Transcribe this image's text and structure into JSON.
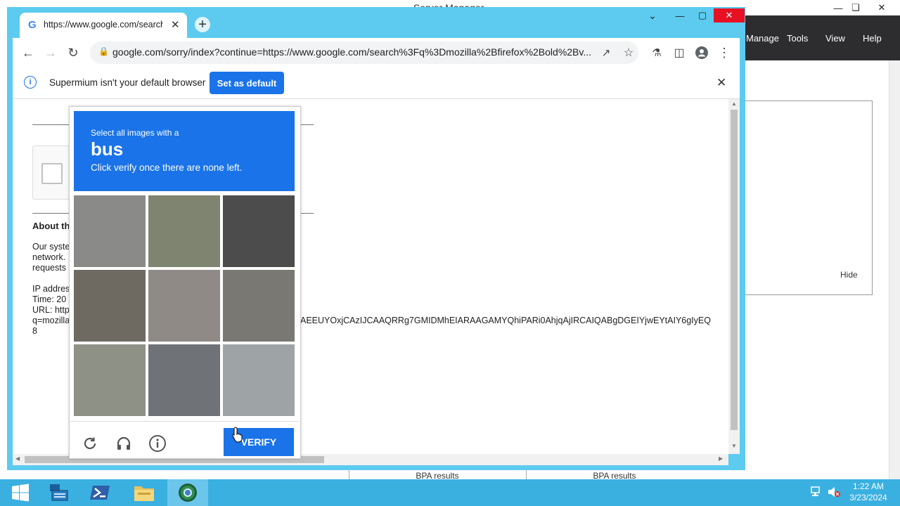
{
  "server_manager": {
    "title": "Server Manager",
    "menu": [
      "Manage",
      "Tools",
      "View",
      "Help"
    ],
    "hide_label": "Hide",
    "bpa_results": [
      "BPA results",
      "BPA results"
    ]
  },
  "browser": {
    "tab_title": "https://www.google.com/search",
    "url": "google.com/sorry/index?continue=https://www.google.com/search%3Fq%3Dmozilla%2Bfirefox%2Bold%2Bv...",
    "infobar": {
      "message": "Supermium isn't your default browser",
      "button": "Set as default"
    }
  },
  "page": {
    "about_heading": "About th",
    "lines_1": [
      "Our syste",
      "network.",
      "requests"
    ],
    "lines_2": [
      "IP addres",
      "Time: 20",
      "URL: http",
      "q=mozilla",
      "8"
    ],
    "url_tail": "AEEUYOxjCAzIJCAAQRRg7GMIDMhEIARAAGAMYQhiPARi0AhjqAjIRCAIQABgDGEIYjwEYtAIY6gIyEQ"
  },
  "captcha": {
    "instruction_line1": "Select all images with a",
    "target": "bus",
    "instruction_line3": "Click verify once there are none left.",
    "verify_label": "VERIFY",
    "tiles": [
      {
        "name": "tile-1",
        "color": "#8a8a88"
      },
      {
        "name": "tile-2",
        "color": "#7f8470"
      },
      {
        "name": "tile-3",
        "color": "#4c4c4c"
      },
      {
        "name": "tile-4",
        "color": "#6e6a62"
      },
      {
        "name": "tile-5",
        "color": "#8f8a86"
      },
      {
        "name": "tile-6",
        "color": "#7a7872"
      },
      {
        "name": "tile-7",
        "color": "#8e9286"
      },
      {
        "name": "tile-8",
        "color": "#6f7378"
      },
      {
        "name": "tile-9",
        "color": "#9ea4a6"
      }
    ]
  },
  "taskbar": {
    "time": "1:22 AM",
    "date": "3/23/2024"
  }
}
